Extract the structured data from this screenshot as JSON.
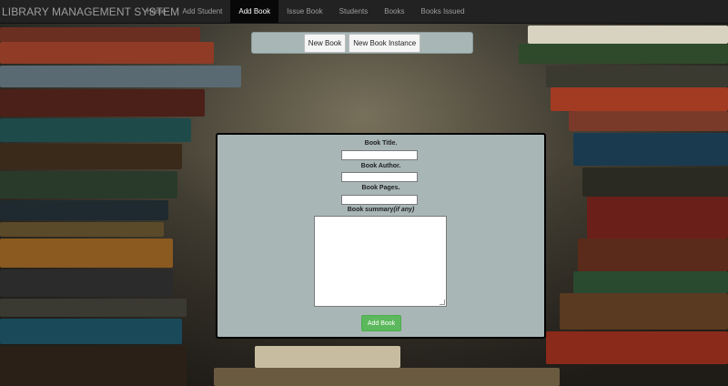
{
  "app": {
    "brand": "LIBRARY MANAGEMENT SYSTEM"
  },
  "nav": {
    "items": [
      {
        "label": "Home"
      },
      {
        "label": "Add Student"
      },
      {
        "label": "Add Book",
        "active": true
      },
      {
        "label": "Issue Book"
      },
      {
        "label": "Students"
      },
      {
        "label": "Books"
      },
      {
        "label": "Books Issued"
      }
    ]
  },
  "tabs": {
    "new_book": "New Book",
    "new_book_instance": "New Book Instance"
  },
  "form": {
    "title_label": "Book Title.",
    "title_value": "",
    "author_label": "Book Author.",
    "author_value": "",
    "pages_label": "Book Pages.",
    "pages_value": "",
    "summary_label": "Book summary",
    "summary_label_suffix": "(if any)",
    "summary_value": "",
    "submit_label": "Add Book"
  },
  "colors": {
    "navbar_bg": "#222222",
    "nav_active_bg": "#080808",
    "panel_bg": "#a9b6b6",
    "submit_bg": "#5cb85c"
  }
}
